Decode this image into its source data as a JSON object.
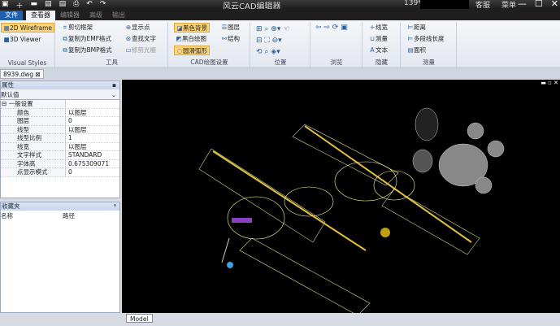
{
  "titlebar": {
    "title": "风云CAD编辑器",
    "user": "139**",
    "links": [
      "客服",
      "菜单"
    ],
    "win": [
      "—",
      "☐",
      "✕"
    ]
  },
  "tabs": [
    "文件",
    "查看器",
    "编辑器",
    "高级",
    "输出"
  ],
  "ribbon": {
    "visual_styles": {
      "label": "Visual Styles",
      "items": [
        "2D Wireframe",
        "3D Viewer"
      ]
    },
    "tools": {
      "label": "工具",
      "items": [
        "剪切框架",
        "复制为EMF格式",
        "复制为BMP格式",
        "显示点",
        "查找文字",
        "修剪光栅"
      ]
    },
    "cad_settings": {
      "label": "CAD绘图设置",
      "items": [
        "黑色背景",
        "黑白绘图",
        "圆滑弧形",
        "图层",
        "结构"
      ]
    },
    "position": {
      "label": "位置"
    },
    "browse": {
      "label": "浏览"
    },
    "hide": {
      "label": "隐藏",
      "items": [
        "线宽",
        "测量",
        "文本"
      ]
    },
    "measure": {
      "label": "测量",
      "items": [
        "距离",
        "多段线长度",
        "面积"
      ]
    }
  },
  "document": {
    "tab": "8939.dwg"
  },
  "properties": {
    "title": "属性",
    "combo": "默认值",
    "section": "一般设置",
    "rows": [
      {
        "k": "颜色",
        "v": "以图层"
      },
      {
        "k": "图层",
        "v": "0"
      },
      {
        "k": "线型",
        "v": "以图层"
      },
      {
        "k": "线型比例",
        "v": "1"
      },
      {
        "k": "线宽",
        "v": "以图层"
      },
      {
        "k": "文字样式",
        "v": "STANDARD"
      },
      {
        "k": "字体高",
        "v": "0.675309071"
      },
      {
        "k": "点显示模式",
        "v": "0"
      }
    ]
  },
  "favorites": {
    "title": "收藏夹",
    "columns": [
      "名称",
      "路径"
    ]
  },
  "model_tab": "Model"
}
